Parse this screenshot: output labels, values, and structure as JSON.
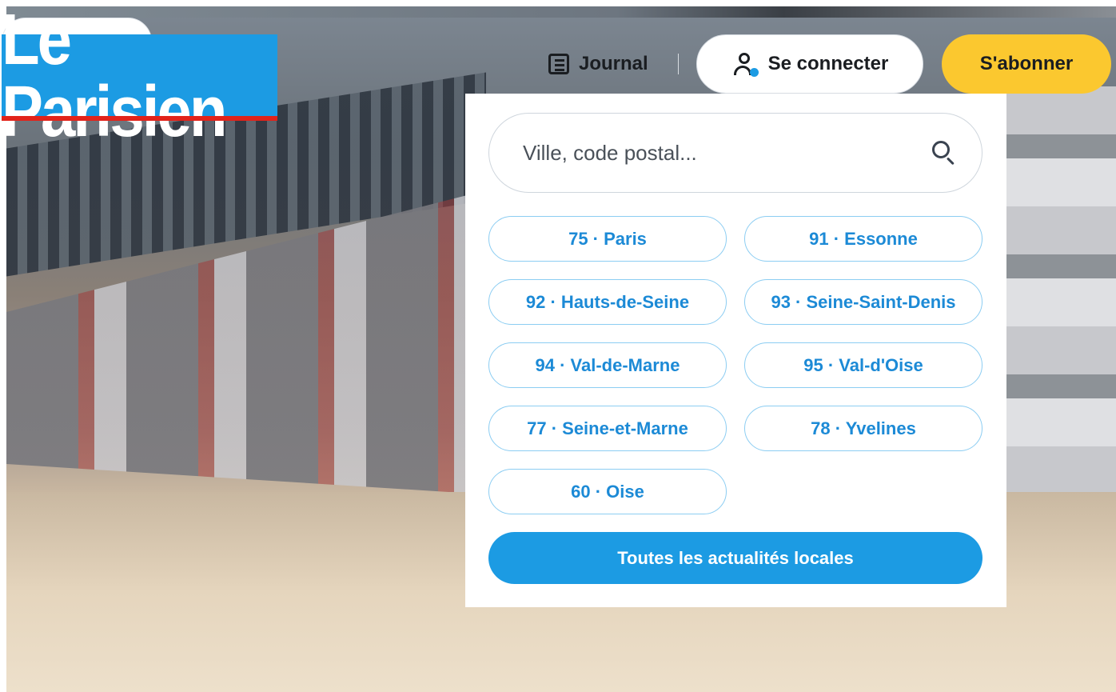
{
  "brand": {
    "logo_text": "Le Parisien",
    "colors": {
      "brand_blue": "#1c9be3",
      "accent_red": "#e2231a",
      "subscribe_yellow": "#fbc82f"
    }
  },
  "header": {
    "journal_label": "Journal",
    "journal_icon": "newspaper-icon",
    "login_label": "Se connecter",
    "login_icon": "user-icon",
    "subscribe_label": "S'abonner"
  },
  "local_menu": {
    "search": {
      "placeholder": "Ville, code postal...",
      "value": "",
      "icon": "search-icon"
    },
    "departments": [
      {
        "label": "75 · Paris"
      },
      {
        "label": "91 · Essonne"
      },
      {
        "label": "92 · Hauts-de-Seine"
      },
      {
        "label": "93 · Seine-Saint-Denis"
      },
      {
        "label": "94 · Val-de-Marne"
      },
      {
        "label": "95 · Val-d'Oise"
      },
      {
        "label": "77 · Seine-et-Marne"
      },
      {
        "label": "78 · Yvelines"
      },
      {
        "label": "60 · Oise"
      }
    ],
    "all_local_label": "Toutes les actualités locales"
  }
}
